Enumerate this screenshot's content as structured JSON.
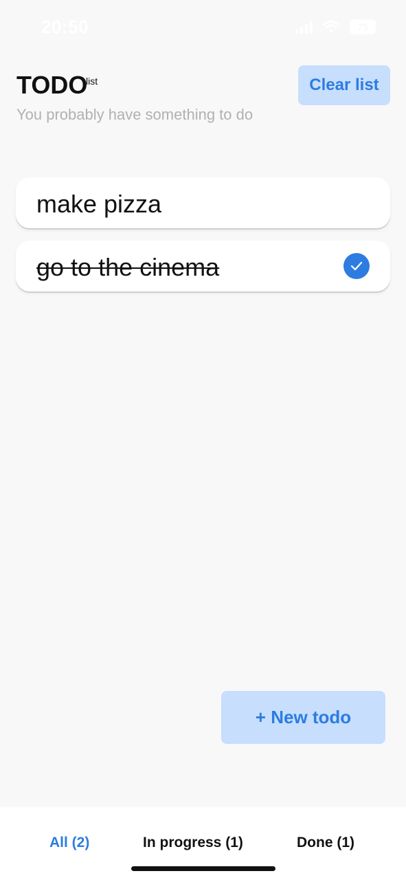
{
  "status_bar": {
    "time": "20:50",
    "battery": "75",
    "icons": [
      "signal-icon",
      "wifi-icon",
      "battery-icon"
    ]
  },
  "header": {
    "title": "TODO",
    "title_superscript": "list",
    "subtitle": "You probably have something to do",
    "clear_button_label": "Clear list"
  },
  "todos": [
    {
      "text": "make pizza",
      "done": false
    },
    {
      "text": "go to the cinema",
      "done": true
    }
  ],
  "new_todo_button_label": "+ New todo",
  "tabs": [
    {
      "label": "All (2)",
      "active": true
    },
    {
      "label": "In progress (1)",
      "active": false
    },
    {
      "label": "Done (1)",
      "active": false
    }
  ],
  "colors": {
    "accent": "#2D7CE0",
    "accent_light": "#C7DEFD",
    "background": "#F8F8F8",
    "subtitle": "#B1B1B1"
  }
}
